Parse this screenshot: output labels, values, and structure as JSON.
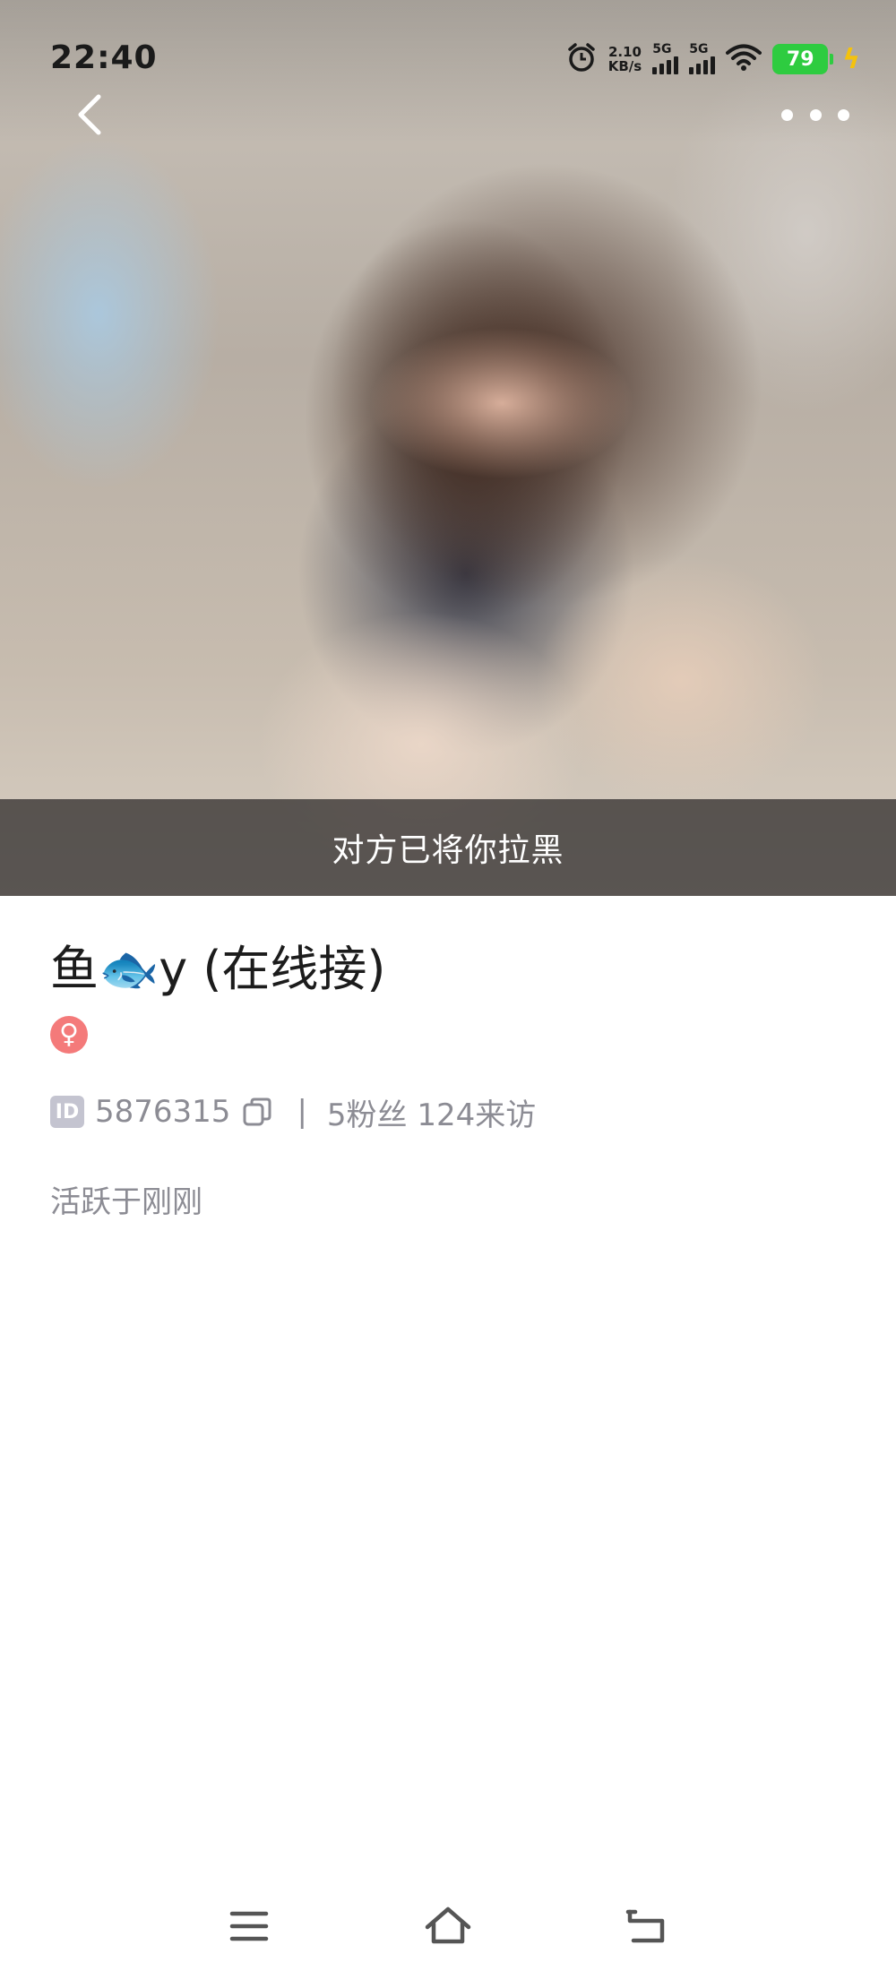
{
  "status_bar": {
    "time": "22:40",
    "net_speed_value": "2.10",
    "net_speed_unit": "KB/s",
    "sim1_gen": "5G",
    "sim2_gen": "5G",
    "battery": "79",
    "charging_icon": "lightning-bolt-icon"
  },
  "header": {
    "back_icon": "chevron-left-icon",
    "more_icon": "more-dots-icon"
  },
  "hero": {
    "banner_text": "对方已将你拉黑"
  },
  "profile": {
    "name": "鱼🐟y (在线接)",
    "gender_symbol": "♀",
    "id_badge": "ID",
    "id": "5876315",
    "stats": "5粉丝 124来访",
    "active_status": "活跃于刚刚"
  },
  "colors": {
    "gender_badge": "#f47a7a",
    "battery": "#2ecc40",
    "secondary_text": "#8c8c94"
  },
  "nav_bar": {
    "icons": [
      "menu-icon",
      "home-icon",
      "back-return-icon"
    ]
  }
}
